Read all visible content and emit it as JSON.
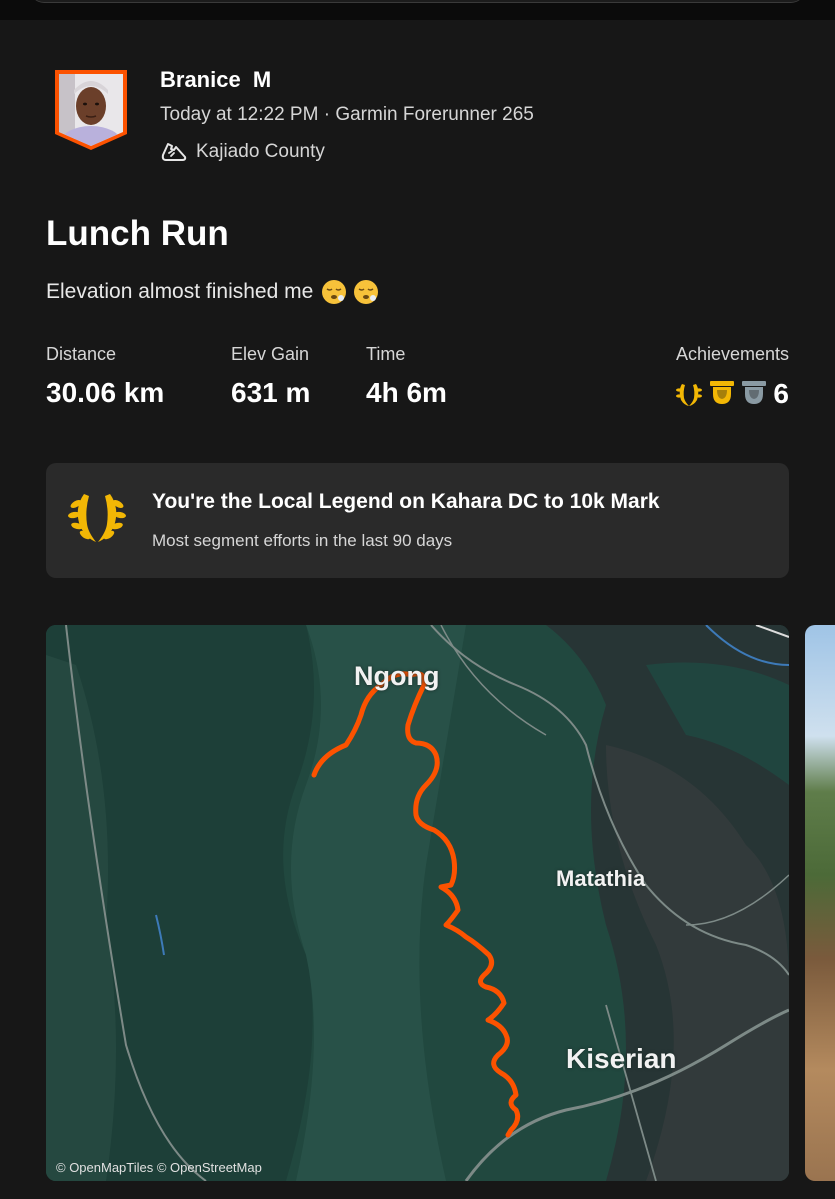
{
  "athlete": {
    "name": "Branice  M",
    "timestamp_device": "Today at 12:22 PM · Garmin Forerunner 265",
    "location": "Kajiado County",
    "activity_icon": "running-shoe-icon"
  },
  "activity": {
    "title": "Lunch Run",
    "description": "Elevation almost finished me",
    "description_emojis": [
      "exhausted-face-emoji",
      "exhausted-face-emoji"
    ]
  },
  "stats": [
    {
      "label": "Distance",
      "value": "30.06 km"
    },
    {
      "label": "Elev Gain",
      "value": "631 m"
    },
    {
      "label": "Time",
      "value": "4h 6m"
    }
  ],
  "achievements": {
    "label": "Achievements",
    "count": "6",
    "icons": [
      "local-legend-laurel-icon",
      "gold-trophy-icon",
      "silver-trophy-icon"
    ]
  },
  "local_legend": {
    "title": "You're the Local Legend on Kahara DC to 10k Mark",
    "subtitle": "Most segment efforts in the last 90 days"
  },
  "map": {
    "places": [
      "Ngong",
      "Matathia",
      "Kiserian"
    ],
    "attribution": "© OpenMapTiles © OpenStreetMap",
    "route_color": "#fc5200"
  },
  "colors": {
    "background": "#171717",
    "card": "#2a2a2a",
    "accent": "#fc5200",
    "gold": "#f2b705"
  }
}
